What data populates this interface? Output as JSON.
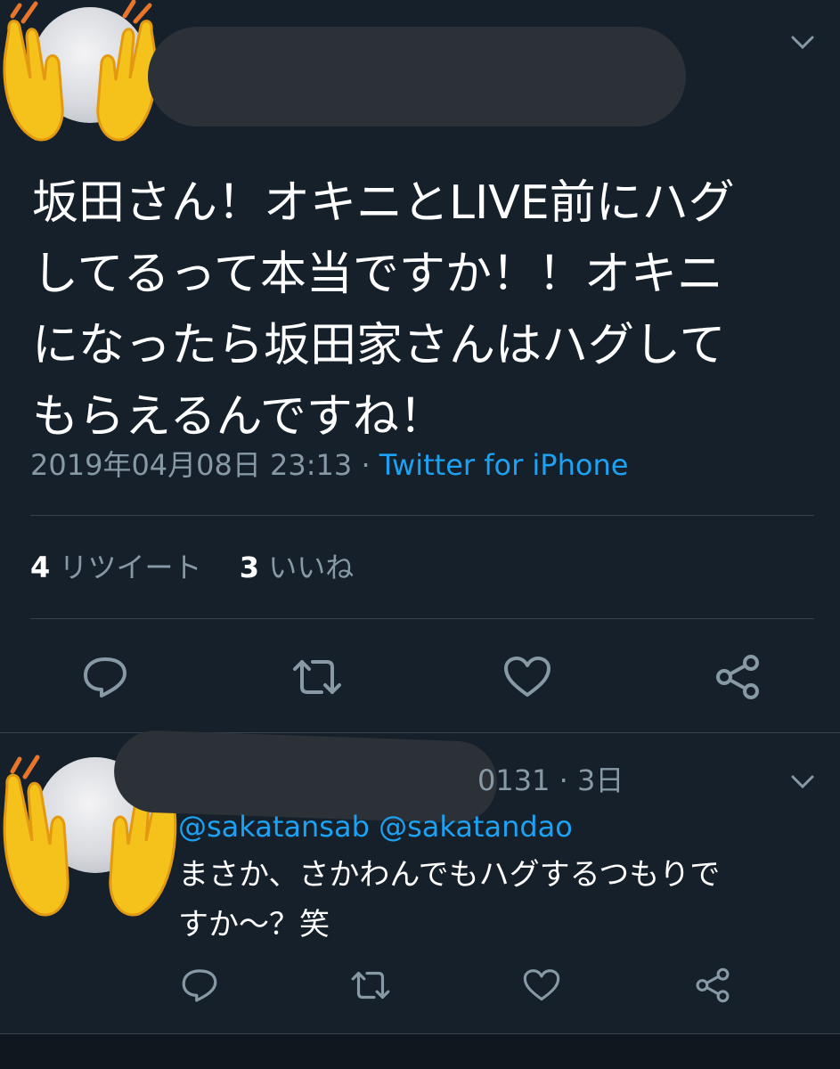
{
  "main_tweet": {
    "text_lines": [
      "坂田さん！オキニとLIVE前にハグ",
      "してるって本当ですか！！オキニ",
      "になったら坂田家さんはハグして",
      "もらえるんですね！"
    ],
    "timestamp": "2019年04月08日 23:13",
    "separator": " · ",
    "source": "Twitter for iPhone",
    "retweet_count": "4",
    "retweet_label": "リツイート",
    "like_count": "3",
    "like_label": "いいね"
  },
  "reply": {
    "handle_suffix": "0131",
    "separator": " · ",
    "time": "3日",
    "mentions": "@sakatansab @sakatandao",
    "text_lines": [
      "まさか、さかわんでもハグするつもりで",
      "すか〜？笑"
    ]
  },
  "icons": {
    "reply": "reply-icon",
    "retweet": "retweet-icon",
    "like": "heart-icon",
    "share": "share-icon",
    "menu": "chevron-down-icon"
  },
  "colors": {
    "background": "#15202b",
    "muted": "#8899a6",
    "link": "#1da1f2",
    "divider": "#38444d",
    "emoji": "#f5c21b"
  }
}
